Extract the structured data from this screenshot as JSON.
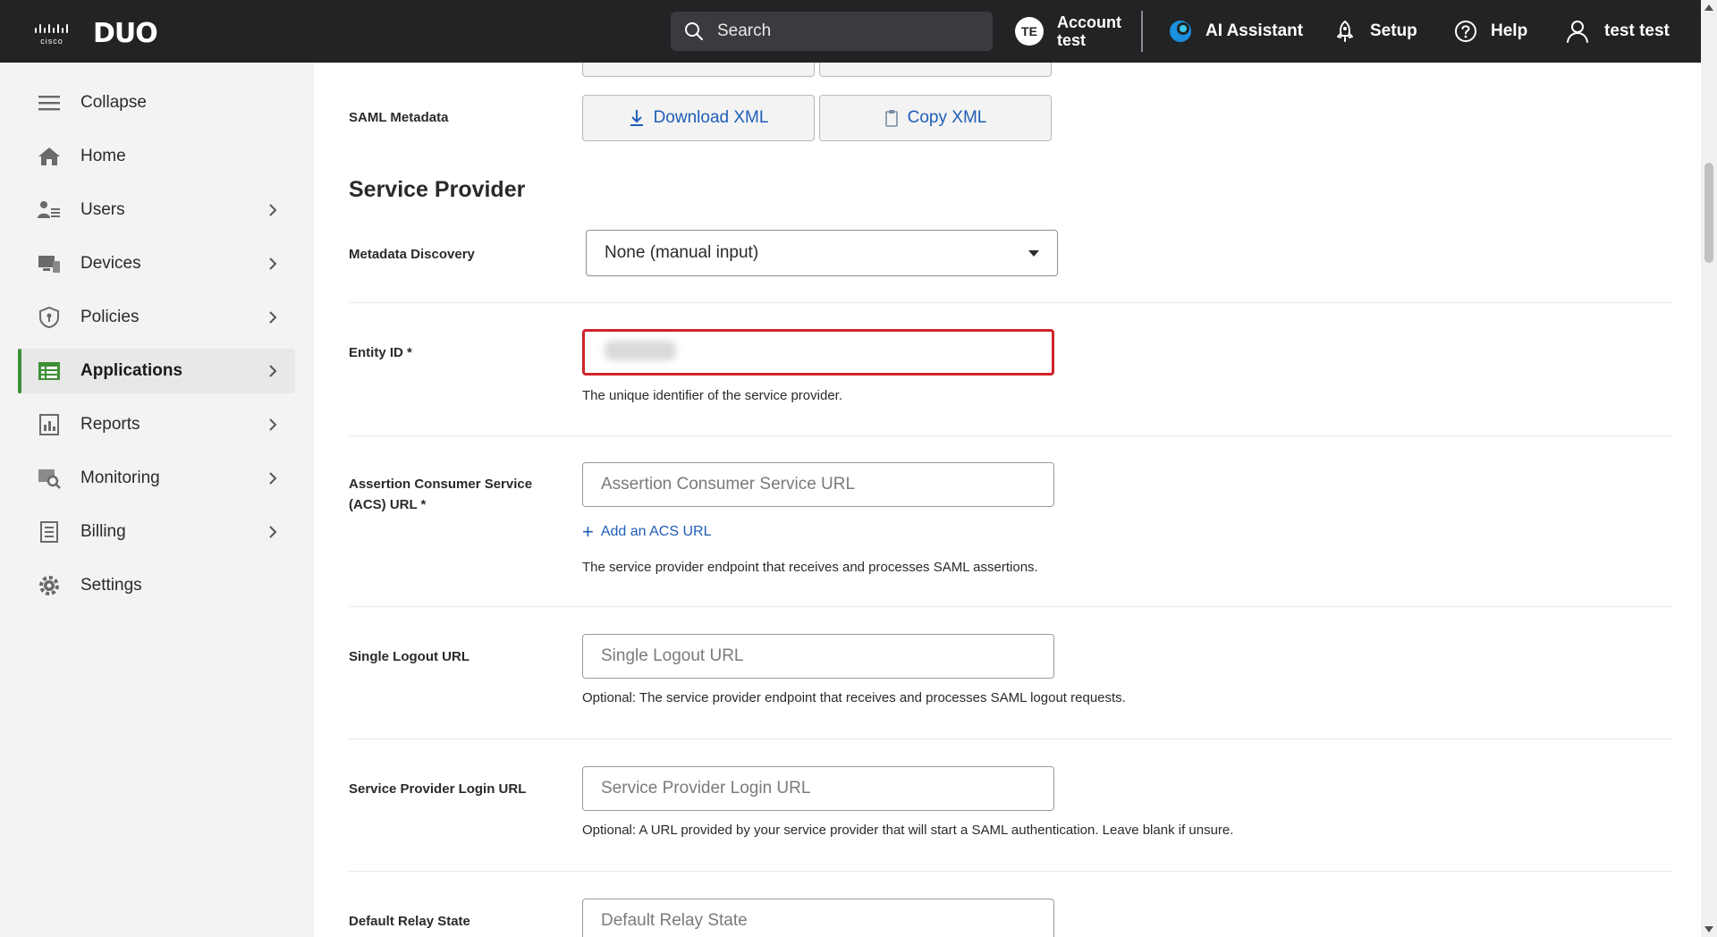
{
  "topbar": {
    "cisco_text": "cisco",
    "brand": "DUO",
    "search_placeholder": "Search",
    "account_initials": "TE",
    "account_line1": "Account",
    "account_line2": "test",
    "ai_assistant": "AI Assistant",
    "setup": "Setup",
    "help": "Help",
    "user": "test test"
  },
  "sidebar": {
    "items": [
      {
        "label": "Collapse",
        "icon": "menu-icon"
      },
      {
        "label": "Home",
        "icon": "home-icon"
      },
      {
        "label": "Users",
        "icon": "users-icon"
      },
      {
        "label": "Devices",
        "icon": "devices-icon"
      },
      {
        "label": "Policies",
        "icon": "shield-icon"
      },
      {
        "label": "Applications",
        "icon": "applications-icon"
      },
      {
        "label": "Reports",
        "icon": "reports-icon"
      },
      {
        "label": "Monitoring",
        "icon": "monitoring-icon"
      },
      {
        "label": "Billing",
        "icon": "billing-icon"
      },
      {
        "label": "Settings",
        "icon": "gear-icon"
      }
    ],
    "active": "Applications"
  },
  "main": {
    "saml_metadata_label": "SAML Metadata",
    "download_xml": "Download XML",
    "copy_xml": "Copy XML",
    "section_title": "Service Provider",
    "metadata_discovery_label": "Metadata Discovery",
    "metadata_discovery_value": "None (manual input)",
    "entity_id_label": "Entity ID *",
    "entity_id_help": "The unique identifier of the service provider.",
    "acs_label_line1": "Assertion Consumer Service",
    "acs_label_line2": "(ACS) URL *",
    "acs_placeholder": "Assertion Consumer Service URL",
    "add_acs": "Add an ACS URL",
    "acs_help": "The service provider endpoint that receives and processes SAML assertions.",
    "slo_label": "Single Logout URL",
    "slo_placeholder": "Single Logout URL",
    "slo_help": "Optional: The service provider endpoint that receives and processes SAML logout requests.",
    "sp_login_label": "Service Provider Login URL",
    "sp_login_placeholder": "Service Provider Login URL",
    "sp_login_help": "Optional: A URL provided by your service provider that will start a SAML authentication. Leave blank if unsure.",
    "relay_label": "Default Relay State",
    "relay_placeholder": "Default Relay State"
  },
  "colors": {
    "topbar_bg": "#222325",
    "accent_green": "#3e8f35",
    "link_blue": "#1f5eb8",
    "error_red": "#d0232b"
  }
}
